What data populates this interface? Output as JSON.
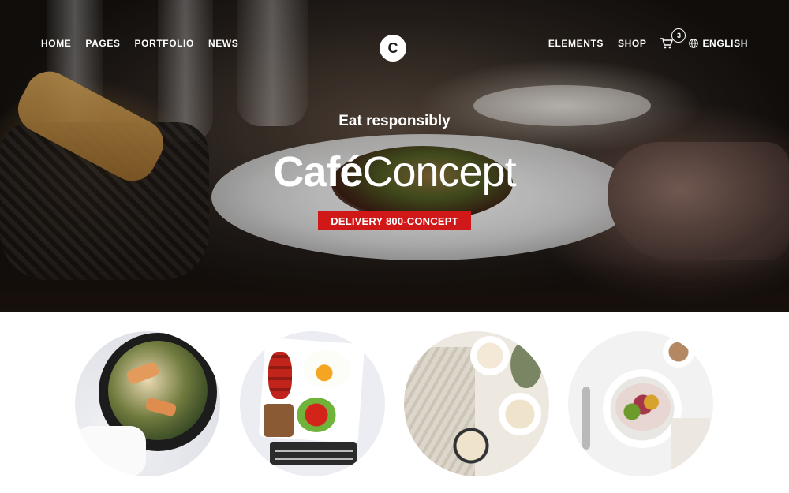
{
  "nav": {
    "left_items": [
      "HOME",
      "PAGES",
      "PORTFOLIO",
      "NEWS"
    ],
    "right_items": [
      "ELEMENTS",
      "SHOP"
    ],
    "logo_letter": "C",
    "cart_count": "3",
    "language": "ENGLISH",
    "icons": [
      "cart-icon",
      "globe-icon"
    ]
  },
  "hero": {
    "tagline": "Eat responsibly",
    "brand_bold": "Café",
    "brand_light": "Concept",
    "cta_label": "DELIVERY 800-CONCEPT"
  },
  "colors": {
    "accent_red": "#d01818",
    "text_white": "#ffffff"
  },
  "dishes": [
    "salmon-spinach-pan",
    "breakfast-platter",
    "granola-bowls",
    "fruit-yogurt-bowl"
  ]
}
